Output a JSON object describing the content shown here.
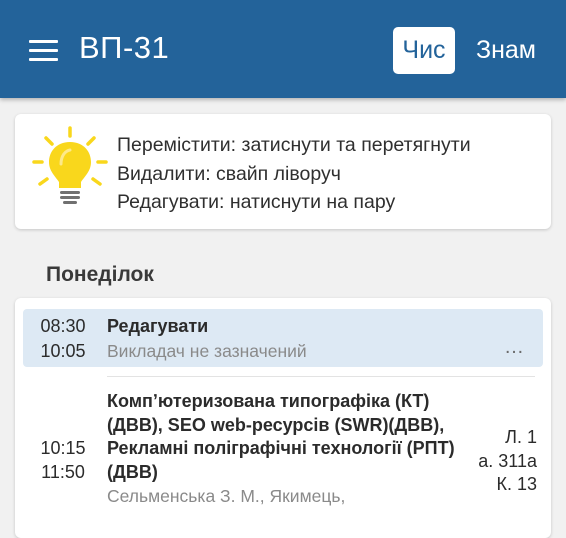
{
  "appbar": {
    "title": "ВП-31",
    "menu_icon": "hamburger-menu-icon",
    "week_toggle": {
      "numerator_label": "Чис",
      "denominator_label": "Знам",
      "active": "numerator"
    },
    "colors": {
      "background": "#23639a",
      "text": "#ffffff"
    }
  },
  "hint": {
    "icon": "lightbulb-icon",
    "lines": [
      "Перемістити: затиснути та перетягнути",
      "Видалити: свайп ліворуч",
      "Редагувати: натиснути на пару"
    ],
    "colors": {
      "bulb": "#f9d71c"
    }
  },
  "day": {
    "title": "Понеділок",
    "pairs": [
      {
        "start": "08:30",
        "end": "10:05",
        "subject": "Редагувати",
        "teacher": "Викладач не зазначений",
        "more": "…",
        "selected": true
      },
      {
        "start": "10:15",
        "end": "11:50",
        "subject_lines": [
          "Компʼютеризована типографіка (КТ)",
          "(ДВВ), SEO web-ресурсів (SWR)(ДВВ),",
          "Рекламні поліграфічні технології (РПТ)",
          "(ДВВ)"
        ],
        "teacher": "Сельменська З. М., Якимець,",
        "room_lines": [
          "Л. 1",
          "а. 311а",
          "К. 13"
        ]
      }
    ],
    "colors": {
      "selected_bg": "#dde9f4",
      "muted_text": "#8a8a8a"
    }
  }
}
